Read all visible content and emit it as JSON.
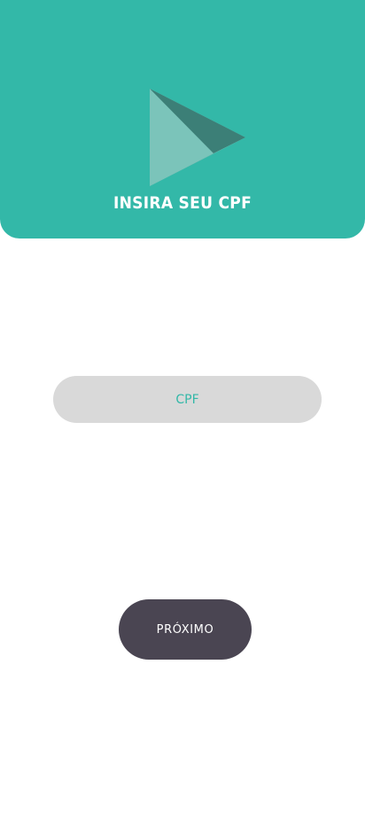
{
  "header": {
    "title": "INSIRA SEU CPF",
    "logo_icon": "play-triangle-logo-icon",
    "background_color": "#33b8a8"
  },
  "form": {
    "cpf_placeholder": "CPF",
    "cpf_value": "",
    "next_label": "PRÓXIMO",
    "field_color": "#d9d9d9",
    "button_color": "#4a4552"
  }
}
